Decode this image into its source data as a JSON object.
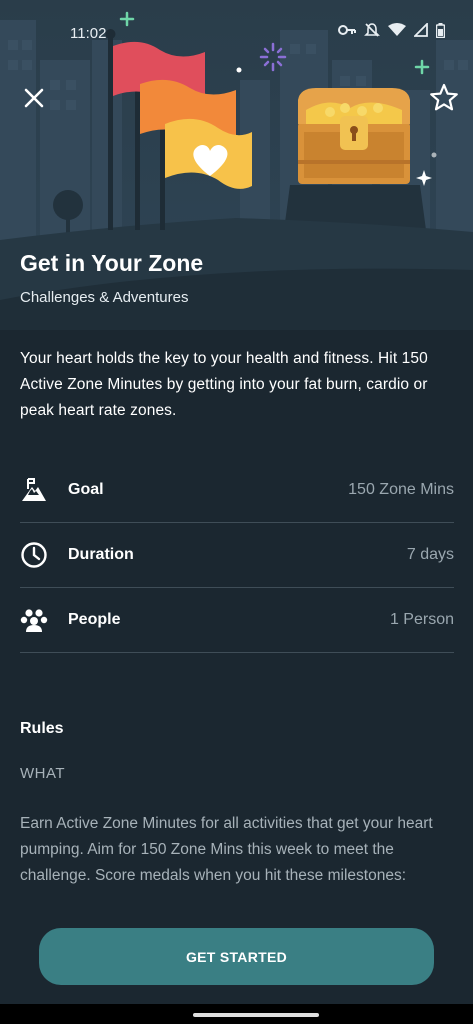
{
  "status_bar": {
    "time": "11:02",
    "icons": [
      "key-icon",
      "notifications-off-icon",
      "wifi-icon",
      "cell-signal-icon",
      "battery-icon"
    ]
  },
  "header": {
    "close_icon": "close-icon",
    "favorite_icon": "star-outline-icon"
  },
  "challenge": {
    "title": "Get in Your Zone",
    "category": "Challenges & Adventures",
    "description": "Your heart holds the key to your health and fitness. Hit 150 Active Zone Minutes by getting into your fat burn, cardio or peak heart rate zones."
  },
  "stats": [
    {
      "icon": "mountain-icon",
      "label": "Goal",
      "value": "150 Zone Mins"
    },
    {
      "icon": "clock-icon",
      "label": "Duration",
      "value": "7 days"
    },
    {
      "icon": "people-icon",
      "label": "People",
      "value": "1 Person"
    }
  ],
  "rules": {
    "title": "Rules",
    "section": "WHAT",
    "text": "Earn Active Zone Minutes for all activities that get your heart pumping. Aim for 150 Zone Mins this week to meet the challenge. Score medals when you hit these milestones:"
  },
  "cta": {
    "label": "GET STARTED"
  },
  "colors": {
    "background": "#1b2730",
    "accent_button": "#3a7f84",
    "hero_sky": "#2d4250",
    "flag_red": "#e04e5c",
    "flag_orange": "#f2893a",
    "flag_yellow": "#f7c24a",
    "chest": "#d9923a"
  }
}
